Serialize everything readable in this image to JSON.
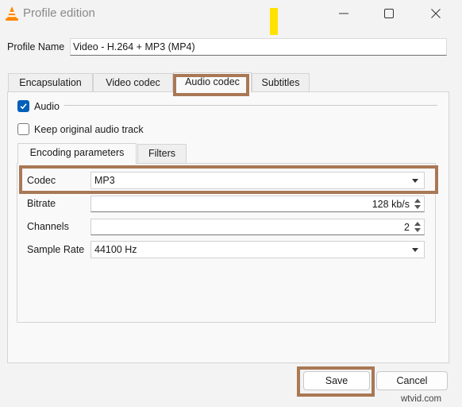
{
  "window": {
    "title": "Profile edition",
    "controls": {
      "minimize_icon": "minimize-icon",
      "maximize_icon": "maximize-icon",
      "close_icon": "close-icon"
    }
  },
  "profile": {
    "label": "Profile Name",
    "value": "Video - H.264 + MP3 (MP4)"
  },
  "tabs": [
    {
      "label": "Encapsulation",
      "active": false
    },
    {
      "label": "Video codec",
      "active": false
    },
    {
      "label": "Audio codec",
      "active": true
    },
    {
      "label": "Subtitles",
      "active": false
    }
  ],
  "audio": {
    "enable_label": "Audio",
    "enable_checked": true,
    "keep_original_label": "Keep original audio track",
    "keep_original_checked": false,
    "subtabs": [
      {
        "label": "Encoding parameters",
        "active": true
      },
      {
        "label": "Filters",
        "active": false
      }
    ],
    "fields": {
      "codec": {
        "label": "Codec",
        "value": "MP3"
      },
      "bitrate": {
        "label": "Bitrate",
        "value": "128 kb/s"
      },
      "channels": {
        "label": "Channels",
        "value": "2"
      },
      "sample_rate": {
        "label": "Sample Rate",
        "value": "44100 Hz"
      }
    }
  },
  "buttons": {
    "save": "Save",
    "cancel": "Cancel"
  },
  "watermark": "wtvid.com",
  "colors": {
    "highlight": "#a97855",
    "marker": "#ffe300",
    "checkbox_accent": "#005fb8"
  }
}
